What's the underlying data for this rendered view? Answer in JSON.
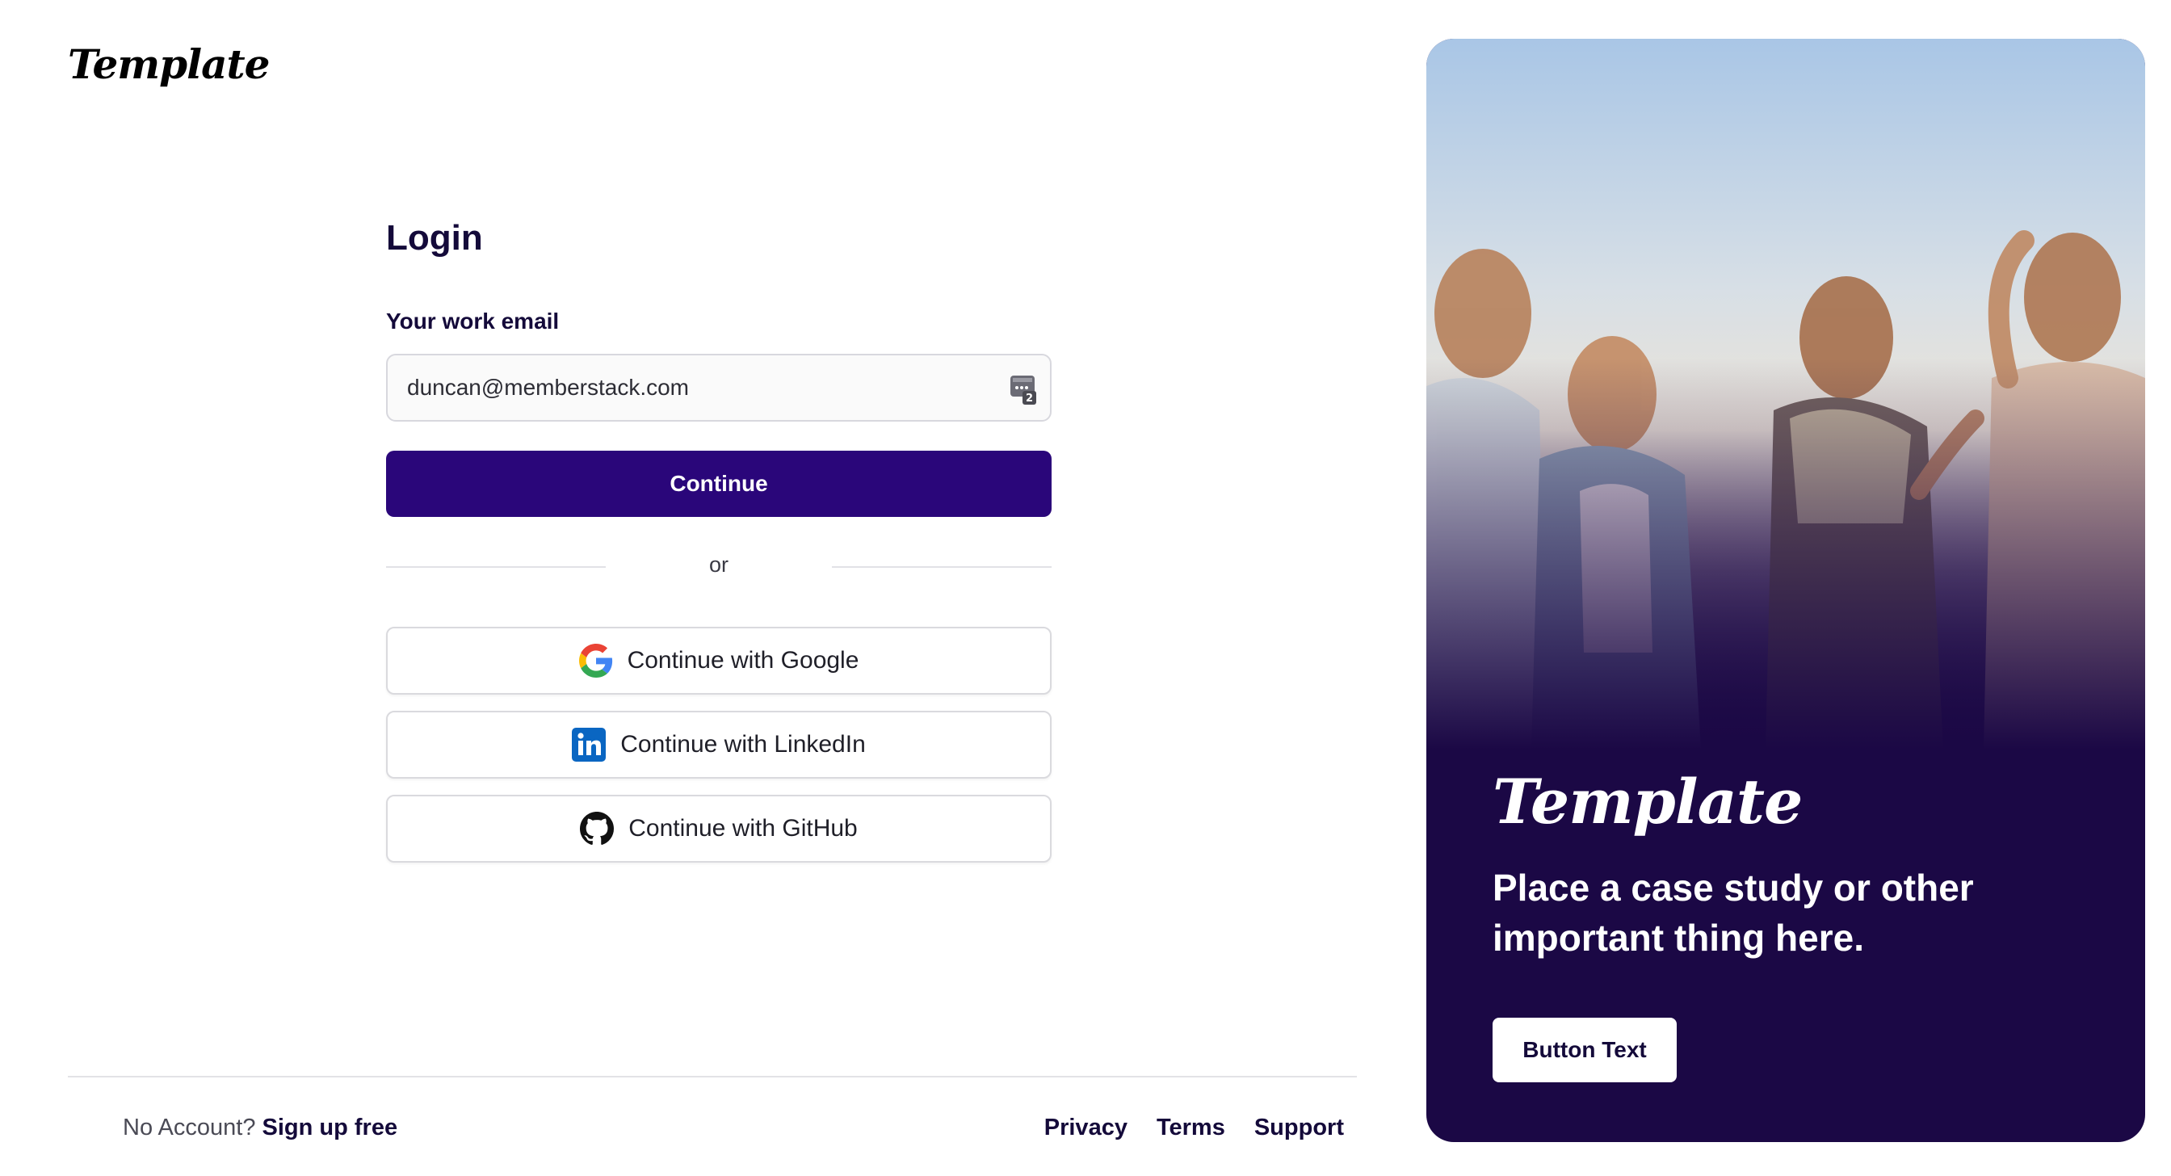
{
  "brand": {
    "logo_text": "Template"
  },
  "login": {
    "title": "Login",
    "email_label": "Your work email",
    "email_value": "duncan@memberstack.com",
    "continue_label": "Continue",
    "divider_text": "or",
    "social_buttons": [
      {
        "label": "Continue with Google",
        "icon": "google-icon"
      },
      {
        "label": "Continue with LinkedIn",
        "icon": "linkedin-icon"
      },
      {
        "label": "Continue with GitHub",
        "icon": "github-icon"
      }
    ]
  },
  "footer": {
    "no_account_text": "No Account?",
    "signup_link": "Sign up free",
    "links": [
      "Privacy",
      "Terms",
      "Support"
    ]
  },
  "promo": {
    "logo_text": "Template",
    "headline": "Place a case study or other important thing here.",
    "button_label": "Button Text"
  },
  "colors": {
    "primary": "#2a067a",
    "promo_background": "#1b0845",
    "heading": "#140a3a"
  }
}
